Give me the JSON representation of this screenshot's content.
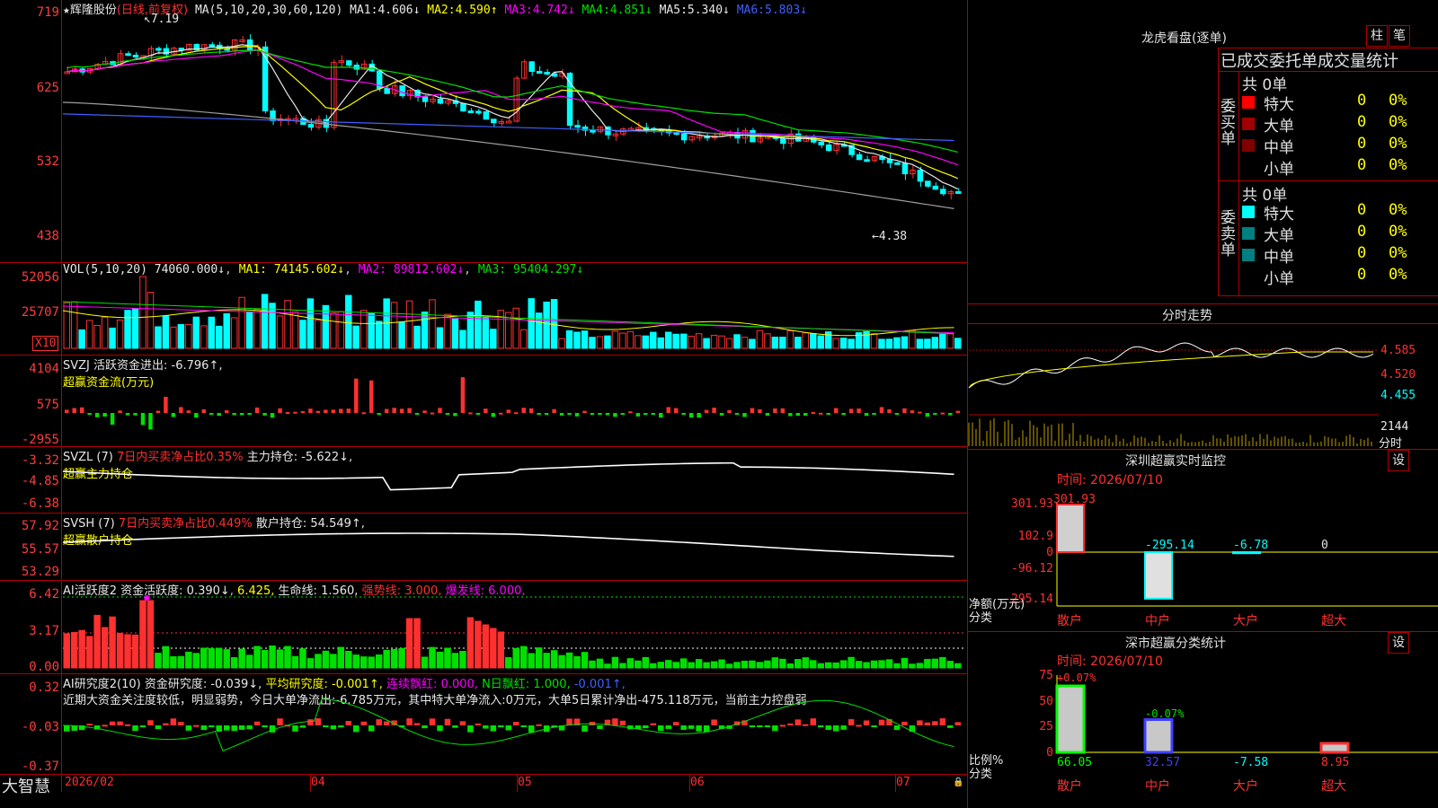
{
  "colors": {
    "up": "#ff3030",
    "down": "#00ffff",
    "frame": "#b00000",
    "ma1": "#e8e8e8",
    "ma2": "#ffff00",
    "ma3": "#ff00ff",
    "ma4": "#00e000",
    "ma5": "#c0c0c0",
    "ma6": "#4060ff"
  },
  "icons": {
    "star": "star-icon",
    "lock": "lock-icon"
  },
  "main": {
    "stock_name": "辉隆股份",
    "mode": "(日线,前复权)",
    "ma_spec": "MA(5,10,20,30,60,120)",
    "ma1_label": "MA1:",
    "ma1_val": "4.606↓",
    "ma2_label": "MA2:",
    "ma2_val": "4.590↑",
    "ma3_label": "MA3:",
    "ma3_val": "4.742↓",
    "ma4_label": "MA4:",
    "ma4_val": "4.851↓",
    "ma5_label": "MA5:",
    "ma5_val": "5.340↓",
    "ma6_label": "MA6:",
    "ma6_val": "5.803↓",
    "axis": [
      "719",
      "625",
      "532",
      "438"
    ],
    "high_mark": "7.19",
    "low_mark": "←4.38"
  },
  "vol": {
    "title": "VOL(5,10,20)",
    "val": "74060.000↓",
    "ma1": "MA1: 74145.602↓",
    "ma2": "MA2: 89812.602↓",
    "ma3": "MA3: 95404.297↓",
    "axis": [
      "52056",
      "25707"
    ],
    "unit": "X10"
  },
  "svzj": {
    "title": "SVZJ  活跃资金进出:",
    "val": "-6.796↑,",
    "sub": "超赢资金流(万元)",
    "axis": [
      "4104",
      "575",
      "-2955"
    ]
  },
  "svzl": {
    "title": "SVZL (7)",
    "t2": "7日内买卖净占比0.35%",
    "t3": "主力持仓:",
    "val": "-5.622↓,",
    "sub": "超赢主力持仓",
    "axis": [
      "-3.32",
      "-4.85",
      "-6.38"
    ]
  },
  "svsh": {
    "title": "SVSH (7)",
    "t2": "7日内买卖净占比0.449%",
    "t3": "散户持仓:",
    "val": "54.549↑,",
    "sub": "超赢散户持仓",
    "axis": [
      "57.92",
      "55.57",
      "53.29"
    ]
  },
  "ai1": {
    "title": "AI活跃度2",
    "t2": "资金活跃度:",
    "v2": "0.390↓",
    "v3": "6.425,",
    "t4": "生命线:",
    "v4": "1.560,",
    "t5": "强势线:",
    "v5": "3.000,",
    "t6": "爆发线:",
    "v6": "6.000,",
    "axis": [
      "6.42",
      "3.17",
      "0.00"
    ]
  },
  "ai2": {
    "title": "AI研究度2(10)",
    "t2": "资金研究度:",
    "v2": "-0.039↓,",
    "t3": "平均研究度:",
    "v3": "-0.001↑,",
    "t4": "连续飘红:",
    "v4": "0.000,",
    "t5": "N日飘红:",
    "v5": "1.000,",
    "v6": "-0.001↑,",
    "note": "近期大资金关注度较低，明显弱势，今日大单净流出:-6.785万元，其中特大单净流入:0万元，大单5日累计净出-475.118万元，当前主力控盘弱",
    "axis": [
      "0.32",
      "-0.03",
      "-0.37"
    ]
  },
  "dates": [
    "2026/02",
    "04",
    "05",
    "06",
    "07"
  ],
  "logo": "大智慧",
  "right": {
    "lhb_title": "龙虎看盘(逐单)",
    "btn1": "柱",
    "btn2": "笔",
    "tabs": "已成交委托单成交量统计",
    "buy_label": "委买单",
    "sell_label": "委卖单",
    "buy_total": "共 0单",
    "sell_total": "共 0单",
    "rows": [
      {
        "name": "特大",
        "n": "0",
        "p": "0%"
      },
      {
        "name": "大单",
        "n": "0",
        "p": "0%"
      },
      {
        "name": "中单",
        "n": "0",
        "p": "0%"
      },
      {
        "name": "小单",
        "n": "0",
        "p": "0%"
      }
    ],
    "fs_title": "分时走势",
    "fs_axis": [
      "4.585",
      "4.520",
      "4.455"
    ],
    "fs_vol": "2144",
    "fs_unit": "分时",
    "mon_title": "深圳超赢实时监控",
    "set1": "设",
    "mon_time": "时间: 2026/07/10",
    "mon_axis": [
      "301.93",
      "102.9",
      "0",
      "-96.12",
      "-295.14"
    ],
    "mon_vals": [
      {
        "cat": "散户",
        "v": "301.93",
        "n": 301.93
      },
      {
        "cat": "中户",
        "v": "-295.14",
        "n": -295.14
      },
      {
        "cat": "大户",
        "v": "-6.78",
        "n": -6.78
      },
      {
        "cat": "超大",
        "v": "0",
        "n": 0
      }
    ],
    "mon_ylabel": "净额(万元)",
    "mon_xlabel": "分类",
    "cls_title": "深市超赢分类统计",
    "set2": "设",
    "cls_time": "时间: 2026/07/10",
    "cls_axis": [
      "75",
      "50",
      "25",
      "0"
    ],
    "cls_top1": "+0.07%",
    "cls_top2": "-0.07%",
    "cls_vals": [
      {
        "cat": "散户",
        "v": "66.05",
        "n": 66.05
      },
      {
        "cat": "中户",
        "v": "32.57",
        "n": 32.57
      },
      {
        "cat": "大户",
        "v": "-7.58",
        "n": -7.58
      },
      {
        "cat": "超大",
        "v": "8.95",
        "n": 8.95
      }
    ],
    "cls_ylabel": "比例%",
    "cls_xlabel": "分类"
  }
}
